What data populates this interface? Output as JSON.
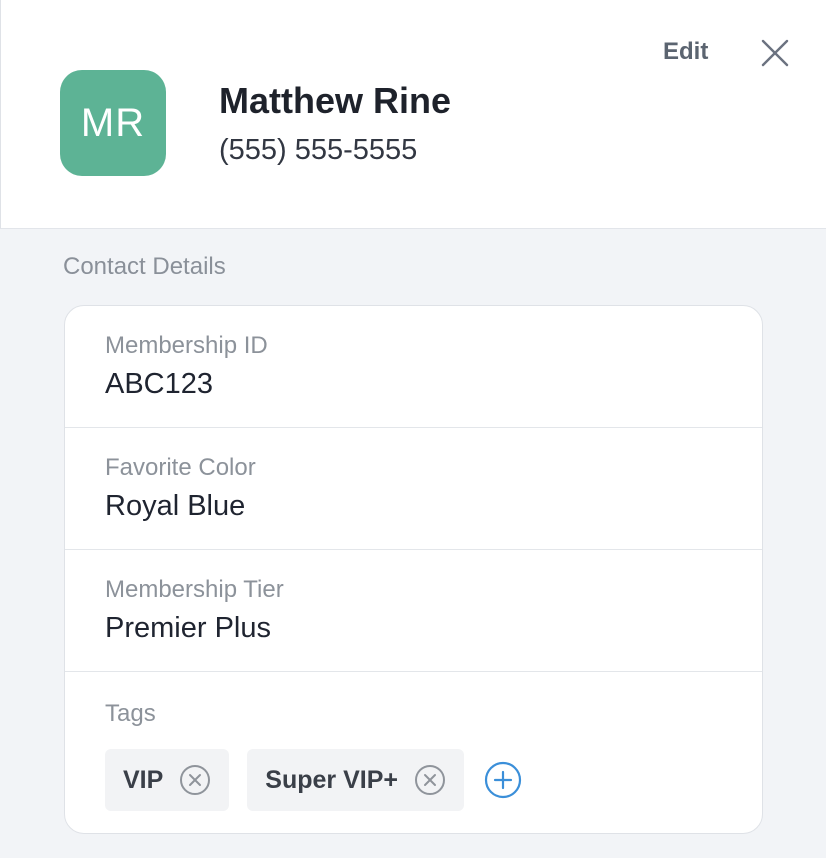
{
  "header": {
    "initials": "MR",
    "name": "Matthew Rine",
    "phone": "(555) 555-5555",
    "edit_label": "Edit",
    "avatar_color": "#5db395"
  },
  "section_title": "Contact Details",
  "fields": [
    {
      "label": "Membership ID",
      "value": "ABC123"
    },
    {
      "label": "Favorite Color",
      "value": "Royal Blue"
    },
    {
      "label": "Membership Tier",
      "value": "Premier Plus"
    }
  ],
  "tags": {
    "label": "Tags",
    "items": [
      "VIP",
      "Super VIP+"
    ],
    "add_icon": "plus-circle-icon",
    "remove_icon": "x-circle-icon",
    "accent": "#3b8fd9"
  },
  "icons": {
    "close": "close-icon"
  }
}
